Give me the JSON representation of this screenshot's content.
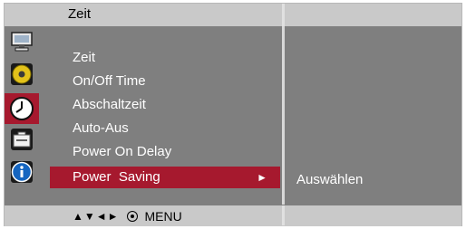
{
  "header": {
    "title": "Zeit"
  },
  "icons": [
    {
      "name": "monitor-icon"
    },
    {
      "name": "audio-icon"
    },
    {
      "name": "clock-icon",
      "selected": true
    },
    {
      "name": "toolbox-icon"
    },
    {
      "name": "info-icon"
    }
  ],
  "menu": {
    "items": [
      {
        "label": "Zeit"
      },
      {
        "label": "On/Off Time"
      },
      {
        "label": "Abschaltzeit"
      },
      {
        "label": "Auto-Aus"
      },
      {
        "label": "Power On Delay"
      },
      {
        "label": "Power  Saving",
        "active": true,
        "arrow": "►"
      }
    ]
  },
  "submenu": {
    "label": "Auswählen"
  },
  "footer": {
    "nav_glyphs": "▲▼◄►",
    "menu_label": "MENU"
  },
  "colors": {
    "background": "#7f7f7f",
    "highlight": "#a6192e",
    "bars": "#c9c9c9"
  }
}
